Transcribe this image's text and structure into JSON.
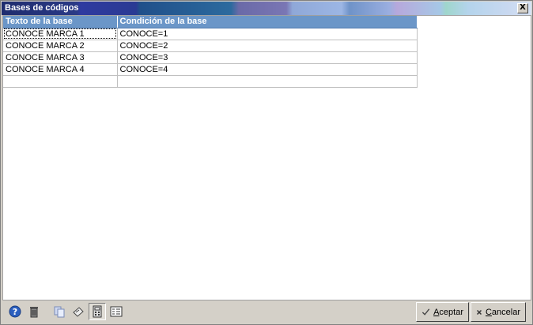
{
  "window": {
    "title": "Bases de códigos",
    "close_label": "X"
  },
  "grid": {
    "columns": [
      "Texto de la base",
      "Condición de la base"
    ],
    "rows": [
      [
        "CONOCE MARCA 1",
        "CONOCE=1"
      ],
      [
        "CONOCE MARCA 2",
        "CONOCE=2"
      ],
      [
        "CONOCE MARCA 3",
        "CONOCE=3"
      ],
      [
        "CONOCE MARCA 4",
        "CONOCE=4"
      ],
      [
        "",
        ""
      ]
    ]
  },
  "toolbar": {
    "icons": [
      "help-icon",
      "trash-icon",
      "copy-icon",
      "paste-icon",
      "calculator-icon",
      "list-icon"
    ]
  },
  "buttons": {
    "accept": "Aceptar",
    "cancel": "Cancelar"
  },
  "colors": {
    "header": "#6b96c8",
    "title_start": "#1f2c6e"
  }
}
